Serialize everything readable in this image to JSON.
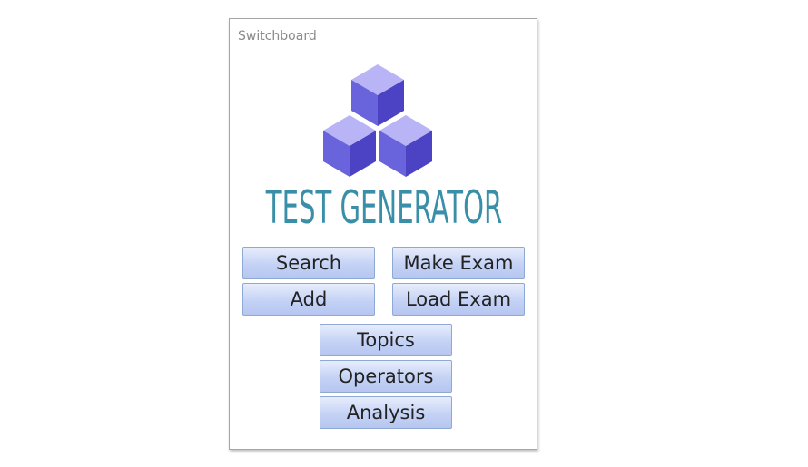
{
  "form": {
    "title": "Switchboard"
  },
  "logo": {
    "text": "TEST GENERATOR",
    "icon": "stacked-cubes-icon",
    "colors": {
      "cube_top": "#b9b4f5",
      "cube_left": "#6a64dc",
      "cube_right": "#4c43c4",
      "text": "#3a8fa8"
    }
  },
  "buttons": {
    "search": "Search",
    "make_exam": "Make Exam",
    "add": "Add",
    "load_exam": "Load Exam",
    "topics": "Topics",
    "operators": "Operators",
    "analysis": "Analysis"
  }
}
